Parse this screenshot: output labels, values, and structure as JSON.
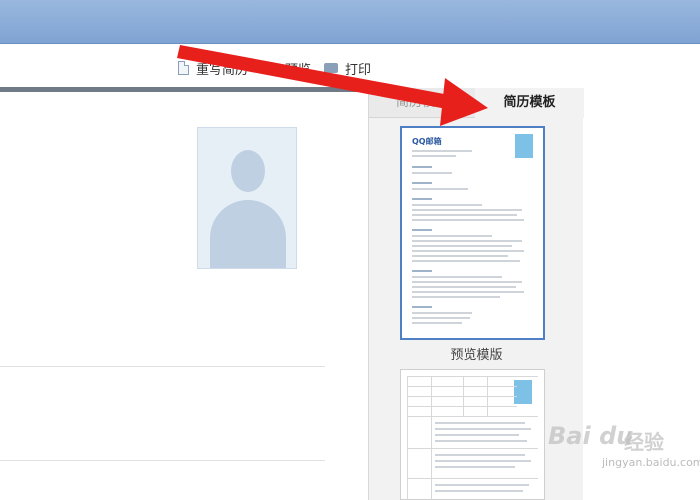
{
  "toolbar": {
    "rewrite_label": "重写简历",
    "preview_label": "预览",
    "print_label": "打印"
  },
  "sidebar": {
    "tabs": [
      {
        "label": "简历模板"
      },
      {
        "label": "简历模板"
      }
    ],
    "preview_template_label": "预览模版",
    "template1_name": "QQ邮箱"
  },
  "watermark": {
    "logo": "Bai du",
    "cn": "经验",
    "url": "jingyan.baidu.com"
  },
  "colors": {
    "accent": "#4f7fc4",
    "arrow": "#e8201c",
    "topbar": "#8aaad6"
  }
}
